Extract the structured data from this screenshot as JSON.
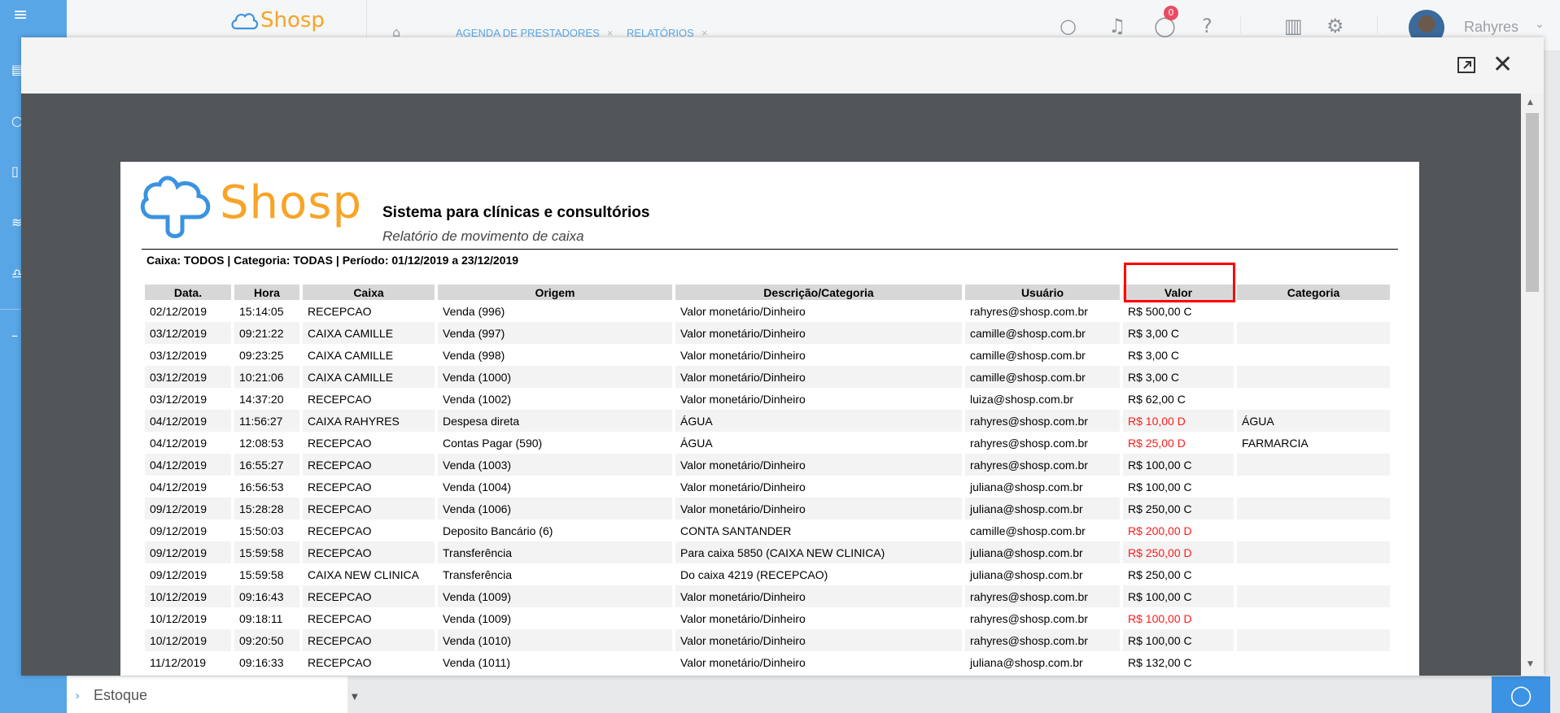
{
  "app": {
    "logo_text": "Shosp",
    "user_name": "Rahyres",
    "notification_count": "0",
    "brand_color": "#58a6e6",
    "accent_color": "#f7a427"
  },
  "header": {
    "tabs": [
      {
        "label": "AGENDA DE PRESTADORES",
        "close": "×"
      },
      {
        "label": "RELATÓRIOS",
        "close": "×"
      }
    ],
    "icons": [
      "home-icon",
      "search-icon",
      "bell-icon",
      "chat-icon",
      "help-icon",
      "chart-icon",
      "gear-icon",
      "chevron-down-icon"
    ]
  },
  "sidebar_bottom": {
    "label": "Estoque"
  },
  "report": {
    "logo_text": "Shosp",
    "title": "Sistema para clínicas e consultórios",
    "subtitle": "Relatório de movimento de caixa",
    "filter": "Caixa: TODOS | Categoria: TODAS | Período: 01/12/2019 a 23/12/2019",
    "columns": [
      "Data.",
      "Hora",
      "Caixa",
      "Origem",
      "Descrição/Categoria",
      "Usuário",
      "Valor",
      "Categoria"
    ],
    "rows": [
      {
        "data": "02/12/2019",
        "hora": "15:14:05",
        "caixa": "RECEPCAO",
        "origem": "Venda (996)",
        "descricao": "Valor monetário/Dinheiro",
        "usuario": "rahyres@shosp.com.br",
        "valor": "R$ 500,00 C",
        "negativo": false,
        "categoria": ""
      },
      {
        "data": "03/12/2019",
        "hora": "09:21:22",
        "caixa": "CAIXA CAMILLE",
        "origem": "Venda (997)",
        "descricao": "Valor monetário/Dinheiro",
        "usuario": "camille@shosp.com.br",
        "valor": "R$ 3,00 C",
        "negativo": false,
        "categoria": ""
      },
      {
        "data": "03/12/2019",
        "hora": "09:23:25",
        "caixa": "CAIXA CAMILLE",
        "origem": "Venda (998)",
        "descricao": "Valor monetário/Dinheiro",
        "usuario": "camille@shosp.com.br",
        "valor": "R$ 3,00 C",
        "negativo": false,
        "categoria": ""
      },
      {
        "data": "03/12/2019",
        "hora": "10:21:06",
        "caixa": "CAIXA CAMILLE",
        "origem": "Venda (1000)",
        "descricao": "Valor monetário/Dinheiro",
        "usuario": "camille@shosp.com.br",
        "valor": "R$ 3,00 C",
        "negativo": false,
        "categoria": ""
      },
      {
        "data": "03/12/2019",
        "hora": "14:37:20",
        "caixa": "RECEPCAO",
        "origem": "Venda (1002)",
        "descricao": "Valor monetário/Dinheiro",
        "usuario": "luiza@shosp.com.br",
        "valor": "R$ 62,00 C",
        "negativo": false,
        "categoria": ""
      },
      {
        "data": "04/12/2019",
        "hora": "11:56:27",
        "caixa": "CAIXA RAHYRES",
        "origem": "Despesa direta",
        "descricao": "ÁGUA",
        "usuario": "rahyres@shosp.com.br",
        "valor": "R$ 10,00 D",
        "negativo": true,
        "categoria": "ÁGUA"
      },
      {
        "data": "04/12/2019",
        "hora": "12:08:53",
        "caixa": "RECEPCAO",
        "origem": "Contas Pagar (590)",
        "descricao": "ÁGUA",
        "usuario": "rahyres@shosp.com.br",
        "valor": "R$ 25,00 D",
        "negativo": true,
        "categoria": "FARMARCIA"
      },
      {
        "data": "04/12/2019",
        "hora": "16:55:27",
        "caixa": "RECEPCAO",
        "origem": "Venda (1003)",
        "descricao": "Valor monetário/Dinheiro",
        "usuario": "rahyres@shosp.com.br",
        "valor": "R$ 100,00 C",
        "negativo": false,
        "categoria": ""
      },
      {
        "data": "04/12/2019",
        "hora": "16:56:53",
        "caixa": "RECEPCAO",
        "origem": "Venda (1004)",
        "descricao": "Valor monetário/Dinheiro",
        "usuario": "juliana@shosp.com.br",
        "valor": "R$ 100,00 C",
        "negativo": false,
        "categoria": ""
      },
      {
        "data": "09/12/2019",
        "hora": "15:28:28",
        "caixa": "RECEPCAO",
        "origem": "Venda (1006)",
        "descricao": "Valor monetário/Dinheiro",
        "usuario": "juliana@shosp.com.br",
        "valor": "R$ 250,00 C",
        "negativo": false,
        "categoria": ""
      },
      {
        "data": "09/12/2019",
        "hora": "15:50:03",
        "caixa": "RECEPCAO",
        "origem": "Deposito Bancário (6)",
        "descricao": "CONTA SANTANDER",
        "usuario": "camille@shosp.com.br",
        "valor": "R$ 200,00 D",
        "negativo": true,
        "categoria": ""
      },
      {
        "data": "09/12/2019",
        "hora": "15:59:58",
        "caixa": "RECEPCAO",
        "origem": "Transferência",
        "descricao": "Para caixa 5850 (CAIXA NEW CLINICA)",
        "usuario": "juliana@shosp.com.br",
        "valor": "R$ 250,00 D",
        "negativo": true,
        "categoria": ""
      },
      {
        "data": "09/12/2019",
        "hora": "15:59:58",
        "caixa": "CAIXA NEW CLINICA",
        "origem": "Transferência",
        "descricao": "Do caixa 4219 (RECEPCAO)",
        "usuario": "juliana@shosp.com.br",
        "valor": "R$ 250,00 C",
        "negativo": false,
        "categoria": ""
      },
      {
        "data": "10/12/2019",
        "hora": "09:16:43",
        "caixa": "RECEPCAO",
        "origem": "Venda (1009)",
        "descricao": "Valor monetário/Dinheiro",
        "usuario": "rahyres@shosp.com.br",
        "valor": "R$ 100,00 C",
        "negativo": false,
        "categoria": ""
      },
      {
        "data": "10/12/2019",
        "hora": "09:18:11",
        "caixa": "RECEPCAO",
        "origem": "Venda (1009)",
        "descricao": "Valor monetário/Dinheiro",
        "usuario": "rahyres@shosp.com.br",
        "valor": "R$ 100,00 D",
        "negativo": true,
        "categoria": ""
      },
      {
        "data": "10/12/2019",
        "hora": "09:20:50",
        "caixa": "RECEPCAO",
        "origem": "Venda (1010)",
        "descricao": "Valor monetário/Dinheiro",
        "usuario": "rahyres@shosp.com.br",
        "valor": "R$ 100,00 C",
        "negativo": false,
        "categoria": ""
      },
      {
        "data": "11/12/2019",
        "hora": "09:16:33",
        "caixa": "RECEPCAO",
        "origem": "Venda (1011)",
        "descricao": "Valor monetário/Dinheiro",
        "usuario": "juliana@shosp.com.br",
        "valor": "R$ 132,00 C",
        "negativo": false,
        "categoria": ""
      }
    ],
    "negative_color": "#ff1a1a",
    "highlight_color": "#ff0000"
  }
}
